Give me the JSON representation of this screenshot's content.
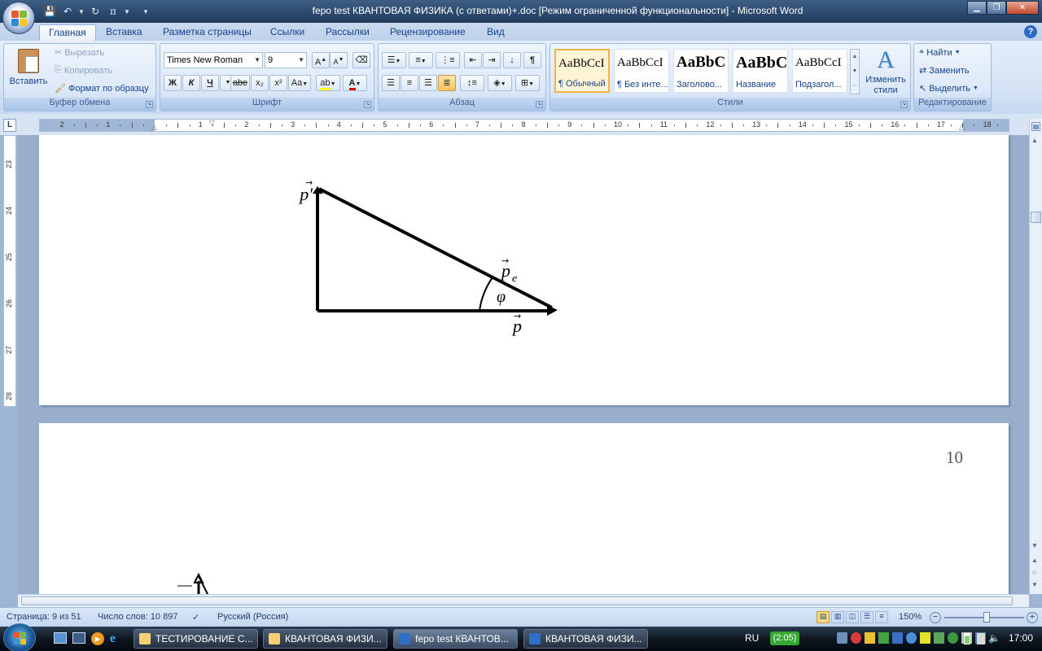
{
  "window": {
    "title": "fepo test КВАНТОВАЯ ФИЗИКА (с ответами)+.doc [Режим ограниченной функциональности] - Microsoft Word"
  },
  "tabs": [
    "Главная",
    "Вставка",
    "Разметка страницы",
    "Ссылки",
    "Рассылки",
    "Рецензирование",
    "Вид"
  ],
  "ribbon": {
    "clipboard": {
      "label": "Буфер обмена",
      "paste": "Вставить",
      "cut": "Вырезать",
      "copy": "Копировать",
      "format_painter": "Формат по образцу"
    },
    "font": {
      "label": "Шрифт",
      "font_name": "Times New Roman",
      "font_size": "9",
      "bold": "Ж",
      "italic": "К",
      "underline": "Ч",
      "strike": "abe",
      "subscript": "x₂",
      "superscript": "x²",
      "change_case": "Aa"
    },
    "paragraph": {
      "label": "Абзац"
    },
    "styles": {
      "label": "Стили",
      "items": [
        {
          "preview": "AaBbCcI",
          "name": "¶ Обычный"
        },
        {
          "preview": "AaBbCcI",
          "name": "¶ Без инте..."
        },
        {
          "preview": "AaBbC",
          "name": "Заголово..."
        },
        {
          "preview": "AaBbC",
          "name": "Название"
        },
        {
          "preview": "AaBbCcI",
          "name": "Подзагол..."
        }
      ],
      "change_styles": "Изменить стили"
    },
    "editing": {
      "label": "Редактирование",
      "find": "Найти",
      "replace": "Заменить",
      "select": "Выделить"
    }
  },
  "ruler": {
    "h_numbers": [
      "2",
      "1",
      "1",
      "2",
      "3",
      "4",
      "5",
      "6",
      "7",
      "8",
      "9",
      "10",
      "11",
      "12",
      "13",
      "14",
      "15",
      "16",
      "17",
      "18"
    ],
    "v_numbers": [
      "23",
      "24",
      "25",
      "26",
      "27",
      "28"
    ]
  },
  "document": {
    "figure_labels": {
      "p_prime": "p′",
      "p_e": "p",
      "p_e_sub": "e",
      "phi": "φ",
      "p": "p"
    },
    "page_number": "10"
  },
  "status": {
    "page": "Страница: 9 из 51",
    "words": "Число слов: 10 897",
    "language": "Русский (Россия)",
    "zoom": "150%"
  },
  "taskbar": {
    "items": [
      "ТЕСТИРОВАНИЕ С...",
      "КВАНТОВАЯ ФИЗИ...",
      "fepo test КВАНТОВ...",
      "КВАНТОВАЯ ФИЗИ..."
    ],
    "lang": "RU",
    "battery": "(2:05)",
    "clock": "17:00"
  },
  "colors": {
    "accent": "#15428b",
    "title_bar": "#2c4a6e",
    "ribbon": "#d5e3f5",
    "workspace": "#98aecb"
  }
}
